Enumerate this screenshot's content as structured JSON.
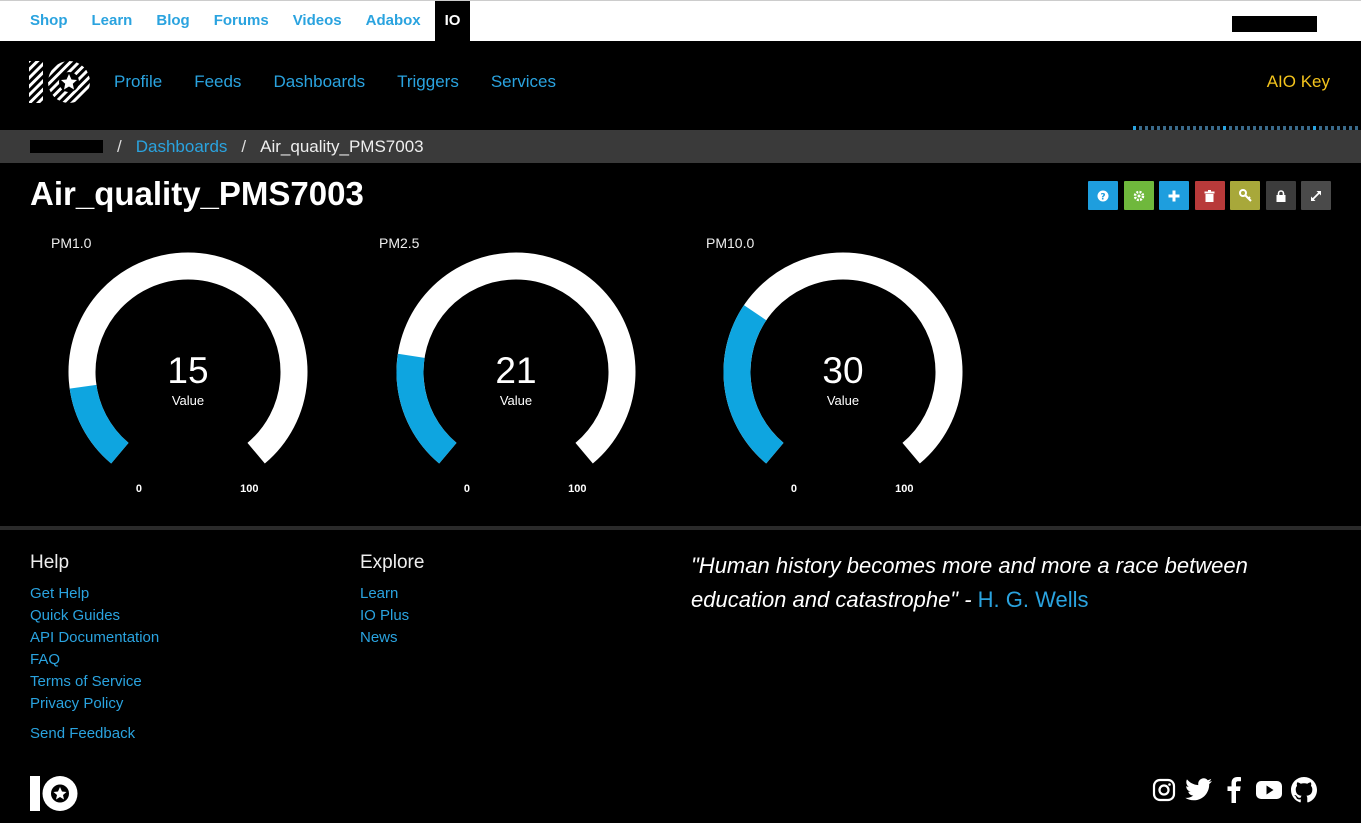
{
  "topbar": {
    "links": [
      "Shop",
      "Learn",
      "Blog",
      "Forums",
      "Videos",
      "Adabox",
      "IO"
    ],
    "active": "IO"
  },
  "nav": {
    "items": [
      "Profile",
      "Feeds",
      "Dashboards",
      "Triggers",
      "Services"
    ],
    "aio_key": "AIO Key"
  },
  "breadcrumb": {
    "separator": "/",
    "dashboards": "Dashboards",
    "current": "Air_quality_PMS7003"
  },
  "dashboard": {
    "title": "Air_quality_PMS7003",
    "tool_buttons": [
      {
        "icon": "help-icon",
        "color": "#1e9ede"
      },
      {
        "icon": "gear-icon",
        "color": "#6fb83c"
      },
      {
        "icon": "plus-icon",
        "color": "#1e9ede"
      },
      {
        "icon": "trash-icon",
        "color": "#b83a3a"
      },
      {
        "icon": "key-icon",
        "color": "#a8a83a"
      },
      {
        "icon": "lock-icon",
        "color": "#3c3c3c"
      },
      {
        "icon": "expand-icon",
        "color": "#4a4a4a"
      }
    ]
  },
  "gauges": [
    {
      "label": "PM1.0",
      "value": "15",
      "caption": "Value",
      "min": "0",
      "max": "100",
      "fraction": 0.15
    },
    {
      "label": "PM2.5",
      "value": "21",
      "caption": "Value",
      "min": "0",
      "max": "100",
      "fraction": 0.21
    },
    {
      "label": "PM10.0",
      "value": "30",
      "caption": "Value",
      "min": "0",
      "max": "100",
      "fraction": 0.3
    }
  ],
  "colors": {
    "accent": "#2aa3df",
    "gauge_fill": "#0ea5e0",
    "gauge_track": "#ffffff",
    "aio_key": "#f3c31c"
  },
  "footer": {
    "help": {
      "heading": "Help",
      "links": [
        "Get Help",
        "Quick Guides",
        "API Documentation",
        "FAQ",
        "Terms of Service",
        "Privacy Policy"
      ],
      "feedback": "Send Feedback"
    },
    "explore": {
      "heading": "Explore",
      "links": [
        "Learn",
        "IO Plus",
        "News"
      ]
    },
    "quote": {
      "text": "\"Human history becomes more and more a race between education and catastrophe\" - ",
      "author": "H. G. Wells"
    },
    "social": [
      "instagram-icon",
      "twitter-icon",
      "facebook-icon",
      "youtube-icon",
      "github-icon"
    ]
  }
}
